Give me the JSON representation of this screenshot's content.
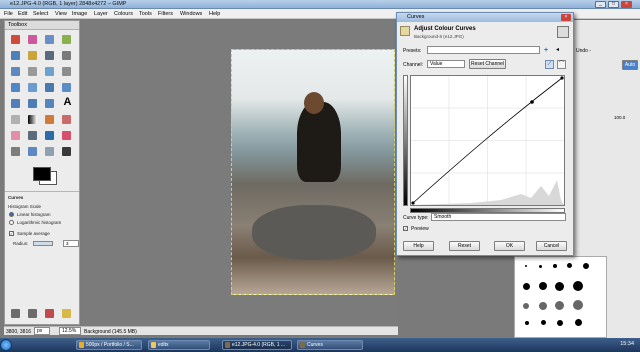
{
  "window": {
    "title": "e12.JPG-4.0 (RGB, 1 layer) 2848x4272 – GIMP"
  },
  "menu": [
    "File",
    "Edit",
    "Select",
    "View",
    "Image",
    "Layer",
    "Colours",
    "Tools",
    "Filters",
    "Windows",
    "Help"
  ],
  "toolbox": {
    "title": "Toolbox",
    "options_title": "Curves",
    "histogram_scale_label": "Histogram Scale",
    "linear_label": "Linear histogram",
    "log_label": "Logarithmic histogram",
    "sample_average_label": "Sample average",
    "radius_label": "Radius:",
    "radius_value": "3"
  },
  "curves": {
    "window_title": "Curves",
    "heading": "Adjust Colour Curves",
    "subheading": "Background-8 (e12.JPG)",
    "presets_label": "Presets:",
    "channel_label": "Channel:",
    "channel_value": "Value",
    "reset_channel": "Reset Channel",
    "curve_type_label": "Curve type:",
    "curve_type_value": "Smooth",
    "preview_label": "Preview",
    "buttons": {
      "help": "Help",
      "reset": "Reset",
      "ok": "OK",
      "cancel": "Cancel"
    }
  },
  "statusbar": {
    "coords": "3800, 3816",
    "unit": "px",
    "zoom": "12.5%",
    "message": "Background (145.5 MB)"
  },
  "right_dock": {
    "tab_label": "Undo -",
    "auto_label": "Auto",
    "value_1000": "100.0"
  },
  "taskbar": {
    "items": [
      {
        "label": "500px / Portfolio / S...",
        "color": "#e8ae2b"
      },
      {
        "label": "editx",
        "color": "#f0c75a"
      },
      {
        "label": "e12.JPG-4.0 (RGB, 1 ...",
        "color": "#7d6b4f"
      },
      {
        "label": "Curves",
        "color": "#7d6b4f"
      }
    ],
    "clock": "15:34"
  },
  "colors": {
    "titlebar": "#9dbbdf",
    "taskbar": "#1d365b"
  }
}
